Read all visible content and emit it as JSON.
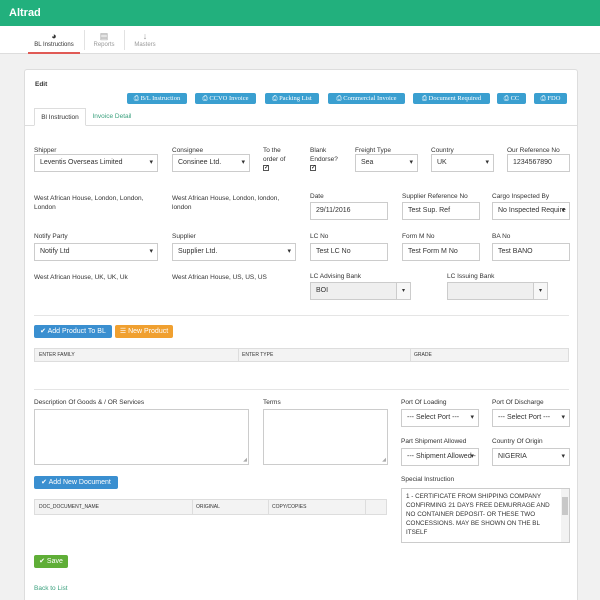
{
  "app": {
    "title": "Altrad"
  },
  "nav": [
    {
      "label": "BL Instructions",
      "icon": "dashboard-icon",
      "active": true
    },
    {
      "label": "Reports",
      "icon": "table-icon",
      "active": false
    },
    {
      "label": "Masters",
      "icon": "arrow-down-icon",
      "active": false
    }
  ],
  "page": {
    "title": "Edit"
  },
  "print_buttons": [
    "B/L Instruction",
    "CCVO Invoice",
    "Packing List",
    "Commercial Invoice",
    "Document Required",
    "CC",
    "FDO"
  ],
  "tabs": [
    {
      "label": "Bl Instruction",
      "active": true
    },
    {
      "label": "Invoice Detail",
      "active": false
    }
  ],
  "form": {
    "shipper": {
      "label": "Shipper",
      "value": "Leventis Overseas Limited",
      "address": "West African House, London, London, London"
    },
    "consignee": {
      "label": "Consignee",
      "value": "Consinee Ltd.",
      "address": "West African House, London, london, london"
    },
    "to_order_of": {
      "label": "To the order of",
      "checked": true
    },
    "blank_endorse": {
      "label": "Blank Endorse?",
      "checked": true
    },
    "freight_type": {
      "label": "Freight Type",
      "value": "Sea"
    },
    "country": {
      "label": "Country",
      "value": "UK"
    },
    "our_reference": {
      "label": "Our Reference No",
      "value": "1234567890"
    },
    "date": {
      "label": "Date",
      "value": "29/11/2016"
    },
    "supplier_reference": {
      "label": "Supplier Reference No",
      "value": "Test Sup. Ref"
    },
    "cargo_inspected_by": {
      "label": "Cargo Inspected By",
      "value": "No Inspected Require"
    },
    "notify_party": {
      "label": "Notify Party",
      "value": "Notify Ltd",
      "address": "West African House, UK, UK, Uk"
    },
    "supplier": {
      "label": "Supplier",
      "value": "Supplier Ltd.",
      "address": "West African House, US, US, US"
    },
    "lc_no": {
      "label": "LC No",
      "value": "Test LC No"
    },
    "form_m_no": {
      "label": "Form M No",
      "value": "Test Form M No"
    },
    "ba_no": {
      "label": "BA No",
      "value": "Test BANO"
    },
    "lc_advising_bank": {
      "label": "LC Advising Bank",
      "value": "BOI"
    },
    "lc_issuing_bank": {
      "label": "LC Issuing Bank",
      "value": ""
    }
  },
  "products": {
    "add_label": "Add Product To BL",
    "new_label": "New Product",
    "columns": [
      "ENTER FAMILY",
      "ENTER TYPE",
      "GRADE"
    ]
  },
  "goods": {
    "description_label": "Description Of Goods & / OR Services",
    "terms_label": "Terms",
    "port_of_loading": {
      "label": "Port Of Loading",
      "value": "--- Select Port ---"
    },
    "port_of_discharge": {
      "label": "Port Of Discharge",
      "value": "--- Select Port ---"
    },
    "part_shipment_allowed": {
      "label": "Part Shipment Allowed",
      "value": "--- Shipment Allowed -"
    },
    "country_of_origin": {
      "label": "Country Of Origin",
      "value": "NIGERIA"
    }
  },
  "documents": {
    "add_label": "Add New Document",
    "columns": [
      "DOC_DOCUMENT_NAME",
      "ORIGINAL",
      "COPY/COPIES"
    ]
  },
  "special_instruction": {
    "label": "Special Instruction",
    "value": "1 - CERTIFICATE FROM SHIPPING COMPANY CONFIRMING 21 DAYS FREE DEMURRAGE AND NO CONTAINER DEPOSIT- OR THESE TWO CONCESSIONS. MAY BE SHOWN ON THE BL ITSELF"
  },
  "actions": {
    "save_label": "Save",
    "back_label": "Back to List"
  },
  "colors": {
    "header": "#22b07d",
    "info_button": "#3a9fd0",
    "primary_button": "#3a8fd0",
    "warning_button": "#f0a030",
    "success_button": "#5fae37",
    "active_tab_underline": "#e05a55"
  }
}
